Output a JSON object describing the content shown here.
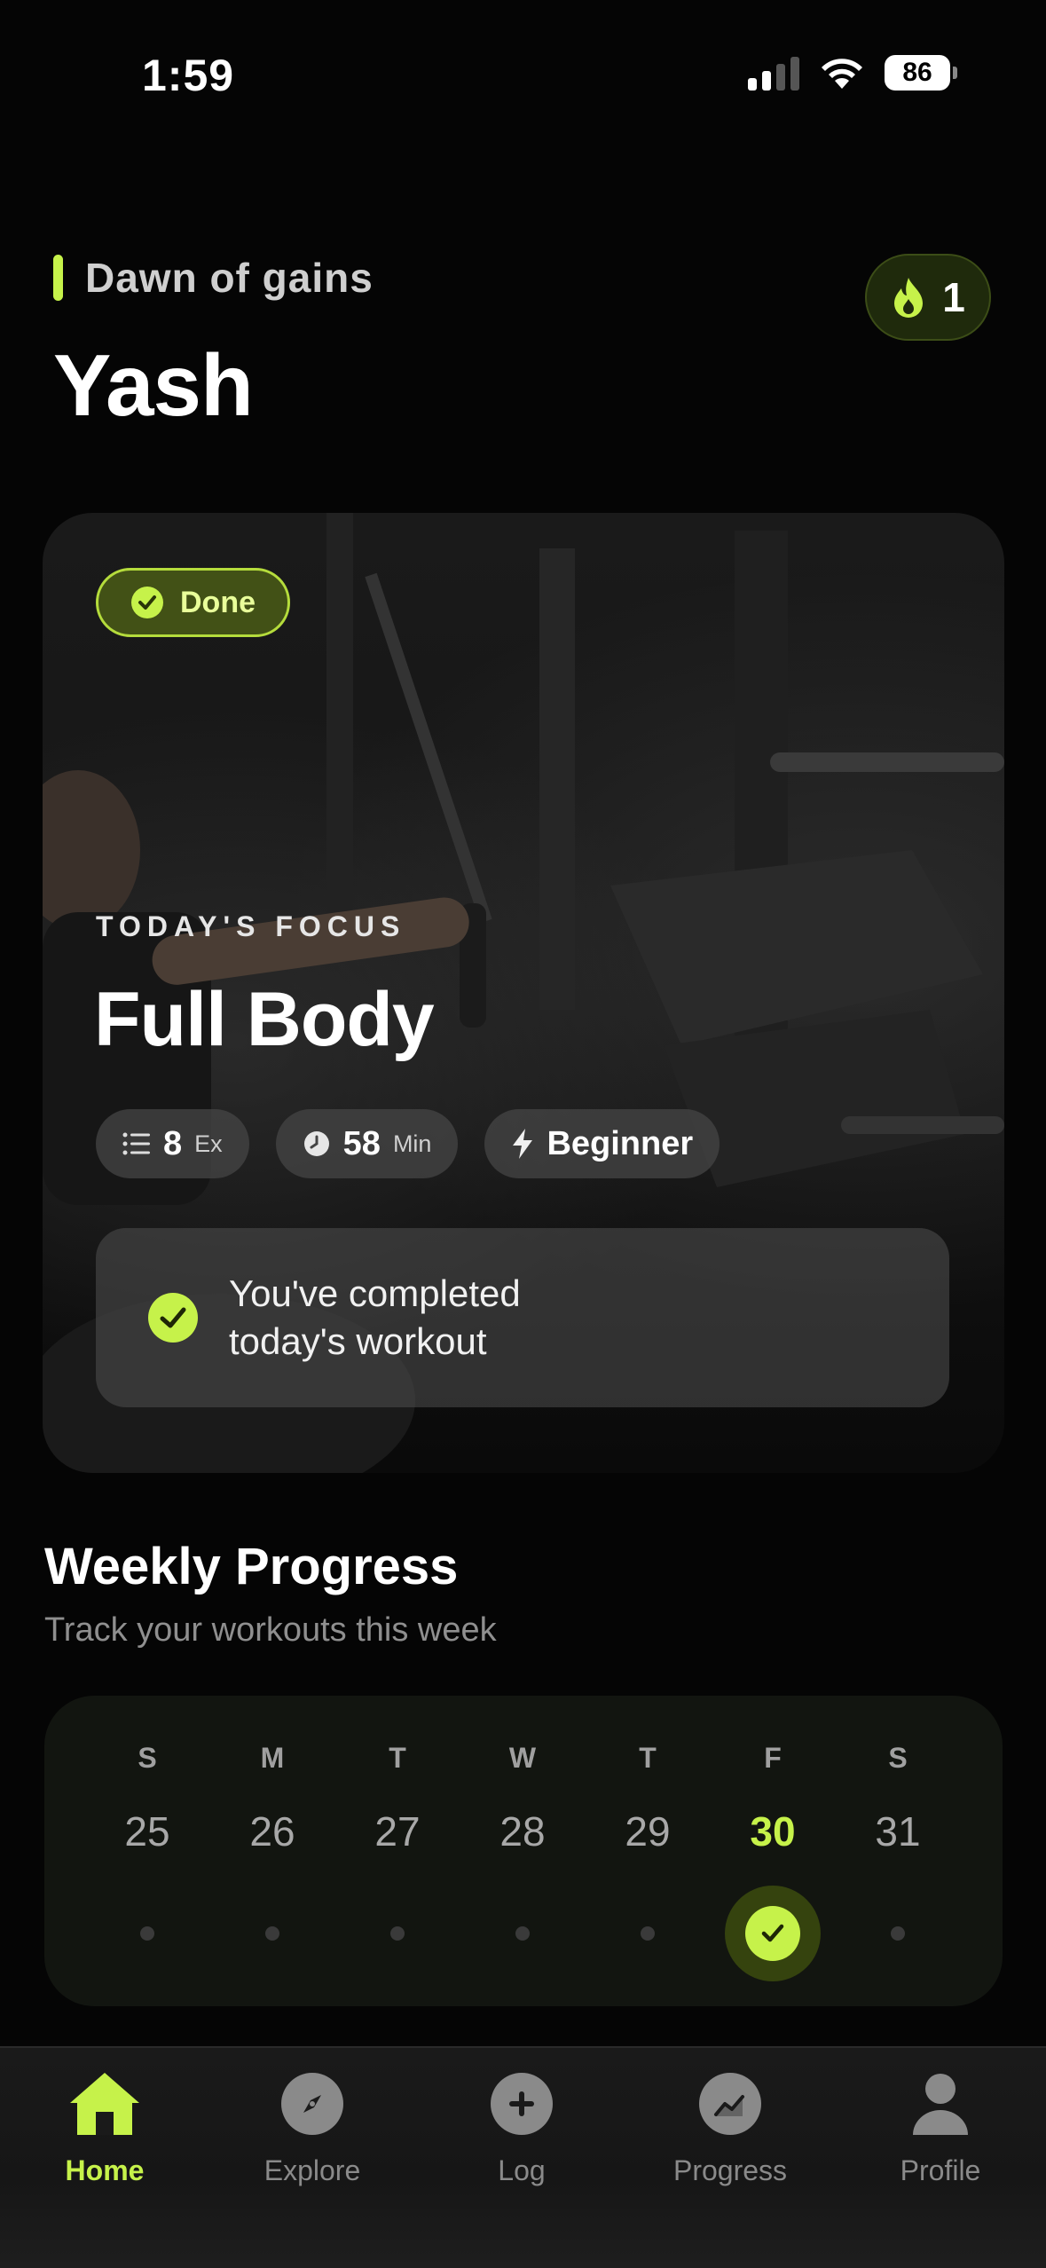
{
  "status_bar": {
    "time": "1:59",
    "battery": "86"
  },
  "header": {
    "greeting": "Dawn of gains",
    "user_name": "Yash",
    "streak_count": "1",
    "streak_icon": "flame-icon"
  },
  "today": {
    "status_badge": "Done",
    "kicker": "TODAY'S FOCUS",
    "title": "Full Body",
    "chips": [
      {
        "icon": "list-icon",
        "value": "8",
        "unit": "Ex"
      },
      {
        "icon": "clock-icon",
        "value": "58",
        "unit": "Min"
      },
      {
        "icon": "bolt-icon",
        "value": "Beginner",
        "unit": ""
      }
    ],
    "completion_message": "You've completed today's workout"
  },
  "weekly": {
    "title": "Weekly Progress",
    "subtitle": "Track your workouts this week",
    "days": [
      {
        "letter": "S",
        "date": "25",
        "completed": false,
        "today": false
      },
      {
        "letter": "M",
        "date": "26",
        "completed": false,
        "today": false
      },
      {
        "letter": "T",
        "date": "27",
        "completed": false,
        "today": false
      },
      {
        "letter": "W",
        "date": "28",
        "completed": false,
        "today": false
      },
      {
        "letter": "T",
        "date": "29",
        "completed": false,
        "today": false
      },
      {
        "letter": "F",
        "date": "30",
        "completed": true,
        "today": true
      },
      {
        "letter": "S",
        "date": "31",
        "completed": false,
        "today": false
      }
    ]
  },
  "tabbar": {
    "tabs": [
      {
        "label": "Home",
        "icon": "home-icon",
        "active": true
      },
      {
        "label": "Explore",
        "icon": "compass-icon",
        "active": false
      },
      {
        "label": "Log",
        "icon": "plus-icon",
        "active": false
      },
      {
        "label": "Progress",
        "icon": "chart-icon",
        "active": false
      },
      {
        "label": "Profile",
        "icon": "person-icon",
        "active": false
      }
    ]
  },
  "colors": {
    "accent": "#c6f24a",
    "background": "#050505",
    "muted_text": "#8f8f8f"
  }
}
